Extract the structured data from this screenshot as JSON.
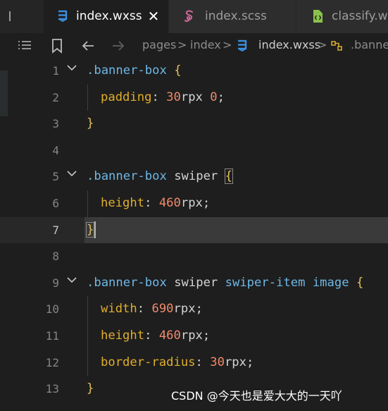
{
  "tabs": [
    {
      "label": "index.wxss",
      "icon": "css-icon",
      "active": true
    },
    {
      "label": "index.scss",
      "icon": "sass-icon",
      "active": false
    },
    {
      "label": "classify.w",
      "icon": "file-code-icon",
      "active": false
    }
  ],
  "breadcrumb": {
    "items": [
      "pages",
      "index",
      "index.wxss",
      ".banner"
    ],
    "separator": ">"
  },
  "editor": {
    "current_line": 7,
    "lines": [
      {
        "n": "1",
        "fold": true
      },
      {
        "n": "2"
      },
      {
        "n": "3"
      },
      {
        "n": "4"
      },
      {
        "n": "5",
        "fold": true
      },
      {
        "n": "6"
      },
      {
        "n": "7",
        "active": true
      },
      {
        "n": "8"
      },
      {
        "n": "9",
        "fold": true
      },
      {
        "n": "10"
      },
      {
        "n": "11"
      },
      {
        "n": "12"
      },
      {
        "n": "13"
      }
    ],
    "code": {
      "l1_sel": ".banner-box",
      "l1_brace": "{",
      "l2_prop": "padding",
      "l2_colon": ":",
      "l2_num1": "30",
      "l2_unit1": "rpx",
      "l2_num2": "0",
      "l2_semi": ";",
      "l3_brace": "}",
      "l5_sel": ".banner-box",
      "l5_tag": "swiper",
      "l5_brace": "{",
      "l6_prop": "height",
      "l6_colon": ":",
      "l6_num": "460",
      "l6_unit": "rpx",
      "l6_semi": ";",
      "l7_brace": "}",
      "l9_sel": ".banner-box",
      "l9_tag1": "swiper",
      "l9_tag2": "swiper-item",
      "l9_tag3": "image",
      "l9_brace": "{",
      "l10_prop": "width",
      "l10_colon": ":",
      "l10_num": "690",
      "l10_unit": "rpx",
      "l10_semi": ";",
      "l11_prop": "height",
      "l11_colon": ":",
      "l11_num": "460",
      "l11_unit": "rpx",
      "l11_semi": ";",
      "l12_prop": "border-radius",
      "l12_colon": ":",
      "l12_num": "30",
      "l12_unit": "rpx",
      "l12_semi": ";",
      "l13_brace": "}"
    }
  },
  "watermark": "CSDN @今天也是爱大大的一天吖",
  "colors": {
    "background": "#1e1e1e",
    "tabbar": "#252526",
    "css_icon": "#3b8fe0",
    "sass_icon": "#cd6799",
    "file_icon": "#8bc34a",
    "property": "#e0ae2c",
    "number": "#f08a6a",
    "selector": "#6fb7e6",
    "brace": "#e5c25a"
  }
}
